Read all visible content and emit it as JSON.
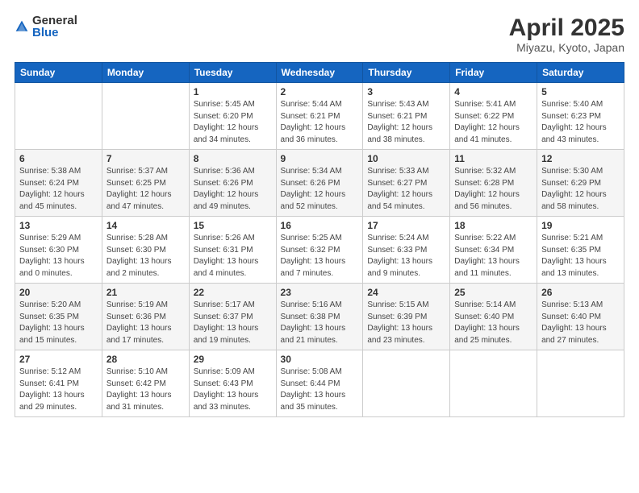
{
  "logo": {
    "general": "General",
    "blue": "Blue"
  },
  "title": "April 2025",
  "subtitle": "Miyazu, Kyoto, Japan",
  "weekdays": [
    "Sunday",
    "Monday",
    "Tuesday",
    "Wednesday",
    "Thursday",
    "Friday",
    "Saturday"
  ],
  "weeks": [
    [
      {
        "day": "",
        "info": ""
      },
      {
        "day": "",
        "info": ""
      },
      {
        "day": "1",
        "info": "Sunrise: 5:45 AM\nSunset: 6:20 PM\nDaylight: 12 hours and 34 minutes."
      },
      {
        "day": "2",
        "info": "Sunrise: 5:44 AM\nSunset: 6:21 PM\nDaylight: 12 hours and 36 minutes."
      },
      {
        "day": "3",
        "info": "Sunrise: 5:43 AM\nSunset: 6:21 PM\nDaylight: 12 hours and 38 minutes."
      },
      {
        "day": "4",
        "info": "Sunrise: 5:41 AM\nSunset: 6:22 PM\nDaylight: 12 hours and 41 minutes."
      },
      {
        "day": "5",
        "info": "Sunrise: 5:40 AM\nSunset: 6:23 PM\nDaylight: 12 hours and 43 minutes."
      }
    ],
    [
      {
        "day": "6",
        "info": "Sunrise: 5:38 AM\nSunset: 6:24 PM\nDaylight: 12 hours and 45 minutes."
      },
      {
        "day": "7",
        "info": "Sunrise: 5:37 AM\nSunset: 6:25 PM\nDaylight: 12 hours and 47 minutes."
      },
      {
        "day": "8",
        "info": "Sunrise: 5:36 AM\nSunset: 6:26 PM\nDaylight: 12 hours and 49 minutes."
      },
      {
        "day": "9",
        "info": "Sunrise: 5:34 AM\nSunset: 6:26 PM\nDaylight: 12 hours and 52 minutes."
      },
      {
        "day": "10",
        "info": "Sunrise: 5:33 AM\nSunset: 6:27 PM\nDaylight: 12 hours and 54 minutes."
      },
      {
        "day": "11",
        "info": "Sunrise: 5:32 AM\nSunset: 6:28 PM\nDaylight: 12 hours and 56 minutes."
      },
      {
        "day": "12",
        "info": "Sunrise: 5:30 AM\nSunset: 6:29 PM\nDaylight: 12 hours and 58 minutes."
      }
    ],
    [
      {
        "day": "13",
        "info": "Sunrise: 5:29 AM\nSunset: 6:30 PM\nDaylight: 13 hours and 0 minutes."
      },
      {
        "day": "14",
        "info": "Sunrise: 5:28 AM\nSunset: 6:30 PM\nDaylight: 13 hours and 2 minutes."
      },
      {
        "day": "15",
        "info": "Sunrise: 5:26 AM\nSunset: 6:31 PM\nDaylight: 13 hours and 4 minutes."
      },
      {
        "day": "16",
        "info": "Sunrise: 5:25 AM\nSunset: 6:32 PM\nDaylight: 13 hours and 7 minutes."
      },
      {
        "day": "17",
        "info": "Sunrise: 5:24 AM\nSunset: 6:33 PM\nDaylight: 13 hours and 9 minutes."
      },
      {
        "day": "18",
        "info": "Sunrise: 5:22 AM\nSunset: 6:34 PM\nDaylight: 13 hours and 11 minutes."
      },
      {
        "day": "19",
        "info": "Sunrise: 5:21 AM\nSunset: 6:35 PM\nDaylight: 13 hours and 13 minutes."
      }
    ],
    [
      {
        "day": "20",
        "info": "Sunrise: 5:20 AM\nSunset: 6:35 PM\nDaylight: 13 hours and 15 minutes."
      },
      {
        "day": "21",
        "info": "Sunrise: 5:19 AM\nSunset: 6:36 PM\nDaylight: 13 hours and 17 minutes."
      },
      {
        "day": "22",
        "info": "Sunrise: 5:17 AM\nSunset: 6:37 PM\nDaylight: 13 hours and 19 minutes."
      },
      {
        "day": "23",
        "info": "Sunrise: 5:16 AM\nSunset: 6:38 PM\nDaylight: 13 hours and 21 minutes."
      },
      {
        "day": "24",
        "info": "Sunrise: 5:15 AM\nSunset: 6:39 PM\nDaylight: 13 hours and 23 minutes."
      },
      {
        "day": "25",
        "info": "Sunrise: 5:14 AM\nSunset: 6:40 PM\nDaylight: 13 hours and 25 minutes."
      },
      {
        "day": "26",
        "info": "Sunrise: 5:13 AM\nSunset: 6:40 PM\nDaylight: 13 hours and 27 minutes."
      }
    ],
    [
      {
        "day": "27",
        "info": "Sunrise: 5:12 AM\nSunset: 6:41 PM\nDaylight: 13 hours and 29 minutes."
      },
      {
        "day": "28",
        "info": "Sunrise: 5:10 AM\nSunset: 6:42 PM\nDaylight: 13 hours and 31 minutes."
      },
      {
        "day": "29",
        "info": "Sunrise: 5:09 AM\nSunset: 6:43 PM\nDaylight: 13 hours and 33 minutes."
      },
      {
        "day": "30",
        "info": "Sunrise: 5:08 AM\nSunset: 6:44 PM\nDaylight: 13 hours and 35 minutes."
      },
      {
        "day": "",
        "info": ""
      },
      {
        "day": "",
        "info": ""
      },
      {
        "day": "",
        "info": ""
      }
    ]
  ]
}
